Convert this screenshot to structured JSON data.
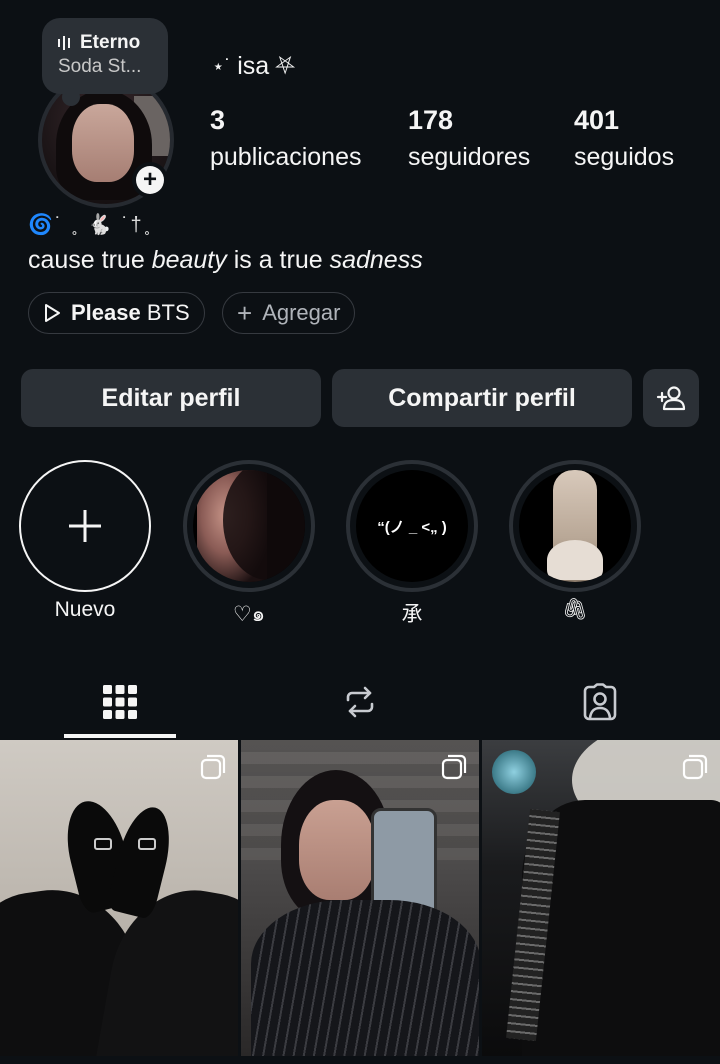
{
  "note": {
    "title": "Eterno",
    "subtitle": "Soda St..."
  },
  "profile": {
    "username": "isa",
    "username_prefix_glyph": "⋆˙",
    "username_suffix_glyph": "⛧",
    "stats": [
      {
        "value": "3",
        "label": "publicaciones"
      },
      {
        "value": "178",
        "label": "seguidores"
      },
      {
        "value": "401",
        "label": "seguidos"
      }
    ],
    "bio_line1": "🌀˙ ˳ 🐇 ˙†˳",
    "bio_line2_parts": [
      "cause true ",
      "beauty",
      " is a true ",
      "sadness"
    ]
  },
  "chips": {
    "music": {
      "title": "Please",
      "artist": "BTS"
    },
    "add": {
      "label": "Agregar"
    }
  },
  "buttons": {
    "edit": "Editar perfil",
    "share": "Compartir perfil"
  },
  "highlights": [
    {
      "label": "Nuevo"
    },
    {
      "label": "♡๑"
    },
    {
      "label": "承",
      "inner_text": "“(ノ _ <„ )"
    },
    {
      "label": "🖇"
    }
  ],
  "colors": {
    "background": "#0c1014",
    "surface": "#2b3036",
    "text": "#f5f5f5",
    "muted": "#b0b4ba"
  }
}
